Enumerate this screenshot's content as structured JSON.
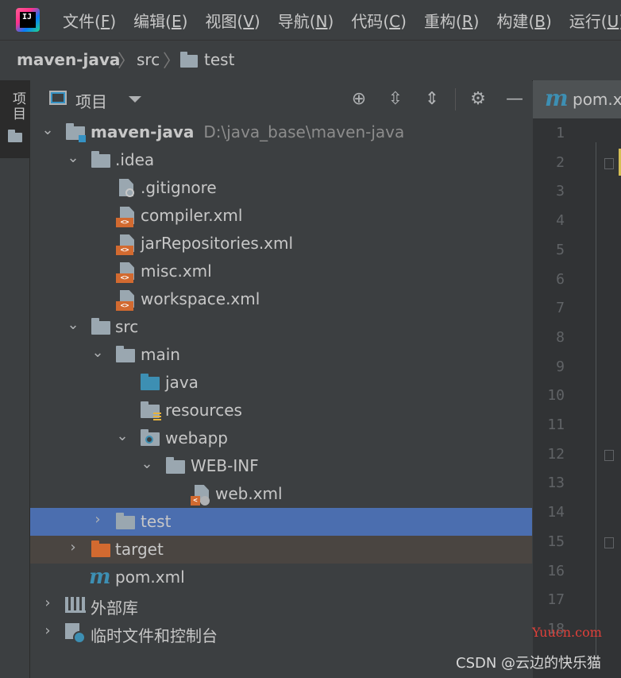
{
  "menu": {
    "items": [
      {
        "label": "文件",
        "mnemonic": "F"
      },
      {
        "label": "编辑",
        "mnemonic": "E"
      },
      {
        "label": "视图",
        "mnemonic": "V"
      },
      {
        "label": "导航",
        "mnemonic": "N"
      },
      {
        "label": "代码",
        "mnemonic": "C"
      },
      {
        "label": "重构",
        "mnemonic": "R"
      },
      {
        "label": "构建",
        "mnemonic": "B"
      },
      {
        "label": "运行",
        "mnemonic": "U"
      }
    ]
  },
  "breadcrumb": {
    "project": "maven-java",
    "sep": "〉",
    "dir1": "src",
    "dir2": "test"
  },
  "toolstrip": {
    "project_label": "项目"
  },
  "panel": {
    "title": "项目"
  },
  "tree": {
    "root_name": "maven-java",
    "root_path": "D:\\java_base\\maven-java",
    "idea": ".idea",
    "gitignore": ".gitignore",
    "compiler": "compiler.xml",
    "jarrepos": "jarRepositories.xml",
    "misc": "misc.xml",
    "workspace": "workspace.xml",
    "src": "src",
    "main": "main",
    "java": "java",
    "resources": "resources",
    "webapp": "webapp",
    "webinf": "WEB-INF",
    "webxml": "web.xml",
    "test": "test",
    "target": "target",
    "pom": "pom.xml",
    "extlibs": "外部库",
    "scratches": "临时文件和控制台"
  },
  "editor": {
    "tab_label": "pom.x",
    "maven_glyph": "m",
    "line_numbers": [
      "1",
      "2",
      "3",
      "4",
      "5",
      "6",
      "7",
      "8",
      "9",
      "10",
      "11",
      "12",
      "13",
      "14",
      "15",
      "16",
      "17",
      "18"
    ]
  },
  "overlay": {
    "watermark": "Yuucn.com",
    "csdn": "CSDN @云边的快乐猫"
  },
  "colors": {
    "selection": "#4b6eaf",
    "excluded_row": "#4a4541",
    "source_folder": "#3d8fb3",
    "excluded_folder": "#d26a30"
  }
}
